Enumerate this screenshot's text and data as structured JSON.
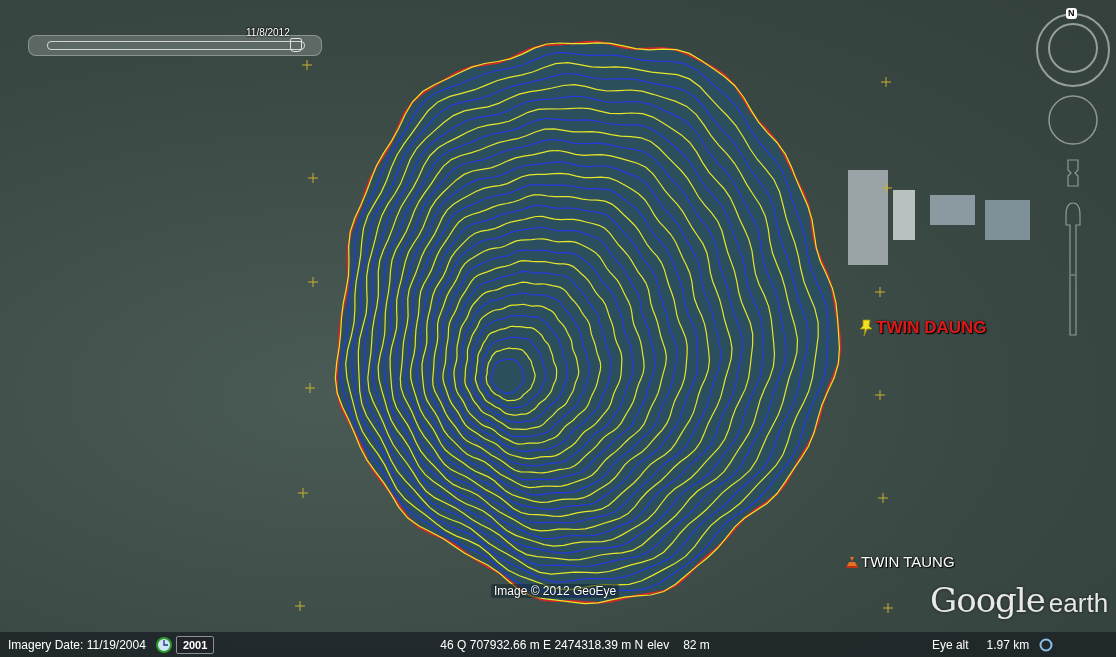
{
  "time_slider": {
    "date": "11/8/2012",
    "level": 0.97
  },
  "navigation": {
    "compass_label": "N"
  },
  "places": [
    {
      "kind": "pushpin",
      "name": "TWIN DAUNG"
    },
    {
      "kind": "volcano",
      "name": "TWIN TAUNG"
    }
  ],
  "attribution": "Image © 2012 GeoEye",
  "logo": {
    "brand": "Google",
    "product": "earth"
  },
  "status_bar": {
    "imagery_date": "Imagery Date: 11/19/2004",
    "historical_year": "2001",
    "coordinates": "46 Q 707932.66 m E 2474318.39 m N",
    "elev_label": "elev",
    "elev_value": "82 m",
    "eye_alt_label": "Eye alt",
    "eye_alt_value": "1.97 km"
  }
}
